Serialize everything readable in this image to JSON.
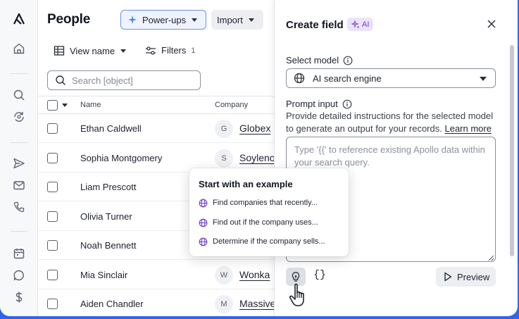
{
  "people": {
    "title": "People",
    "powerups_label": "Power-ups",
    "import_label": "Import",
    "view_label": "View name",
    "filters_label": "Filters",
    "filters_count": "1",
    "search_placeholder": "Search [object]",
    "columns": {
      "name": "Name",
      "company": "Company"
    },
    "rows": [
      {
        "name": "Ethan Caldwell",
        "initial": "G",
        "company": "Globex"
      },
      {
        "name": "Sophia Montgomery",
        "initial": "S",
        "company": "Soylenc"
      },
      {
        "name": "Liam Prescott",
        "initial": "",
        "company": ""
      },
      {
        "name": "Olivia Turner",
        "initial": "",
        "company": ""
      },
      {
        "name": "Noah Bennett",
        "initial": "",
        "company": ""
      },
      {
        "name": "Mia Sinclair",
        "initial": "W",
        "company": "Wonka"
      },
      {
        "name": "Aiden Chandler",
        "initial": "M",
        "company": "Massive"
      }
    ]
  },
  "panel": {
    "title": "Create field",
    "badge": "AI",
    "select_model_label": "Select model",
    "model_value": "AI search engine",
    "prompt_label": "Prompt input",
    "prompt_desc": "Provide detailed instructions for the selected model to generate an output for your records.",
    "learn_more": "Learn more",
    "prompt_placeholder": "Type '{{' to reference existing Apollo data within your search query.",
    "braces": "{}",
    "preview_label": "Preview"
  },
  "popover": {
    "title": "Start with an example",
    "items": [
      "Find companies that recently...",
      "Find out if the company uses...",
      "Determine if the company sells..."
    ]
  },
  "colors": {
    "accent": "#2f66e8",
    "ai_purple": "#6b3fc9",
    "ai_badge_bg": "#ece3fb"
  }
}
